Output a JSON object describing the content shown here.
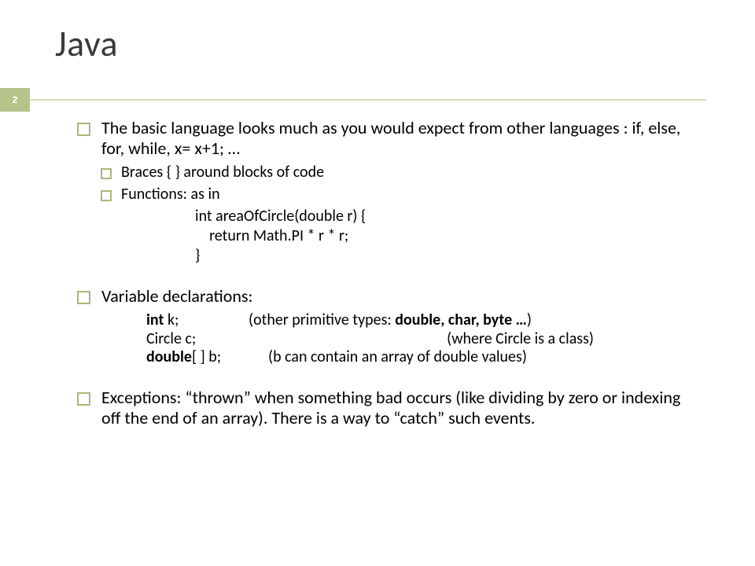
{
  "title": "Java",
  "page": "2",
  "bullets": [
    {
      "text": "The basic language looks much as you would expect from other languages : if, else, for, while, x= x+1; …",
      "sub": [
        "Braces {  } around blocks of code",
        "Functions: as in"
      ]
    },
    {
      "text": "Variable declarations:"
    },
    {
      "text": "Exceptions: “thrown” when something bad occurs (like dividing by zero or indexing off the end of an array).  There is a way to “catch” such events."
    }
  ],
  "code": [
    "int areaOfCircle(double r) {",
    "return Math.PI * r * r;",
    "}"
  ],
  "decls": [
    {
      "kw": "int",
      "var": "k;",
      "note_pre": "other primitive types: ",
      "note_bold": "double, char, byte …"
    },
    {
      "left": "Circle c;",
      "note": "(where Circle is a class)"
    },
    {
      "kw": "double",
      "suffix": "[ ] b;",
      "note": "(b can contain an array of double values)"
    }
  ]
}
